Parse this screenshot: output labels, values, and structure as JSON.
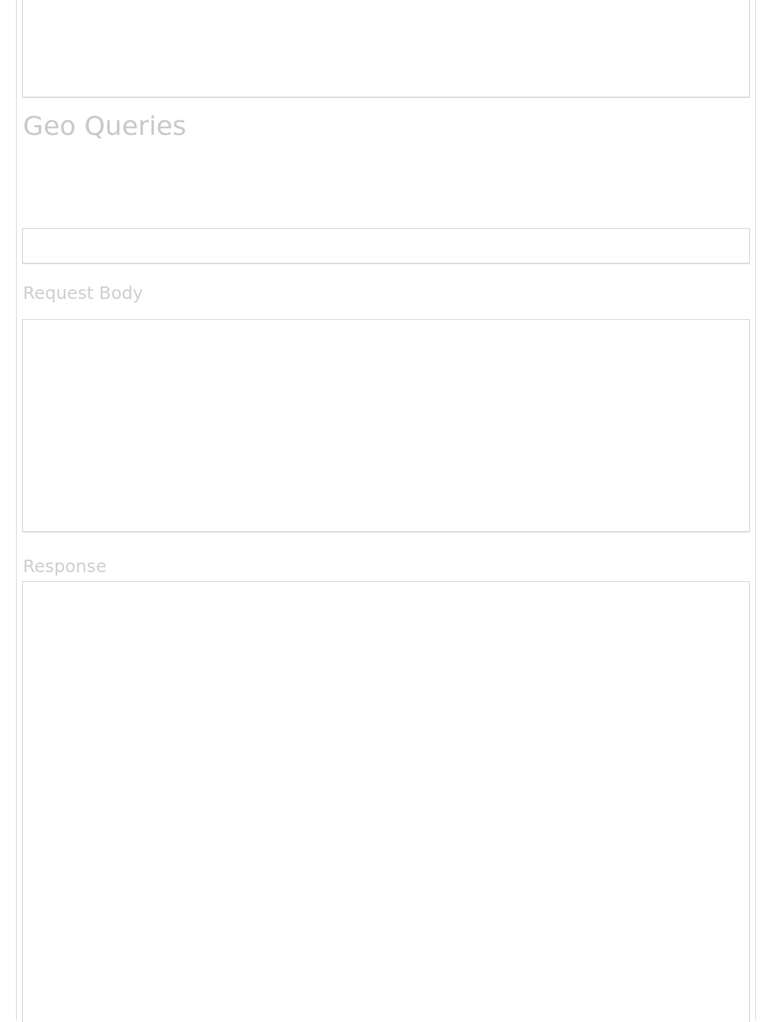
{
  "heading": "Geo Queries",
  "request_body": {
    "label": "Request Body"
  },
  "response": {
    "label": "Response"
  }
}
